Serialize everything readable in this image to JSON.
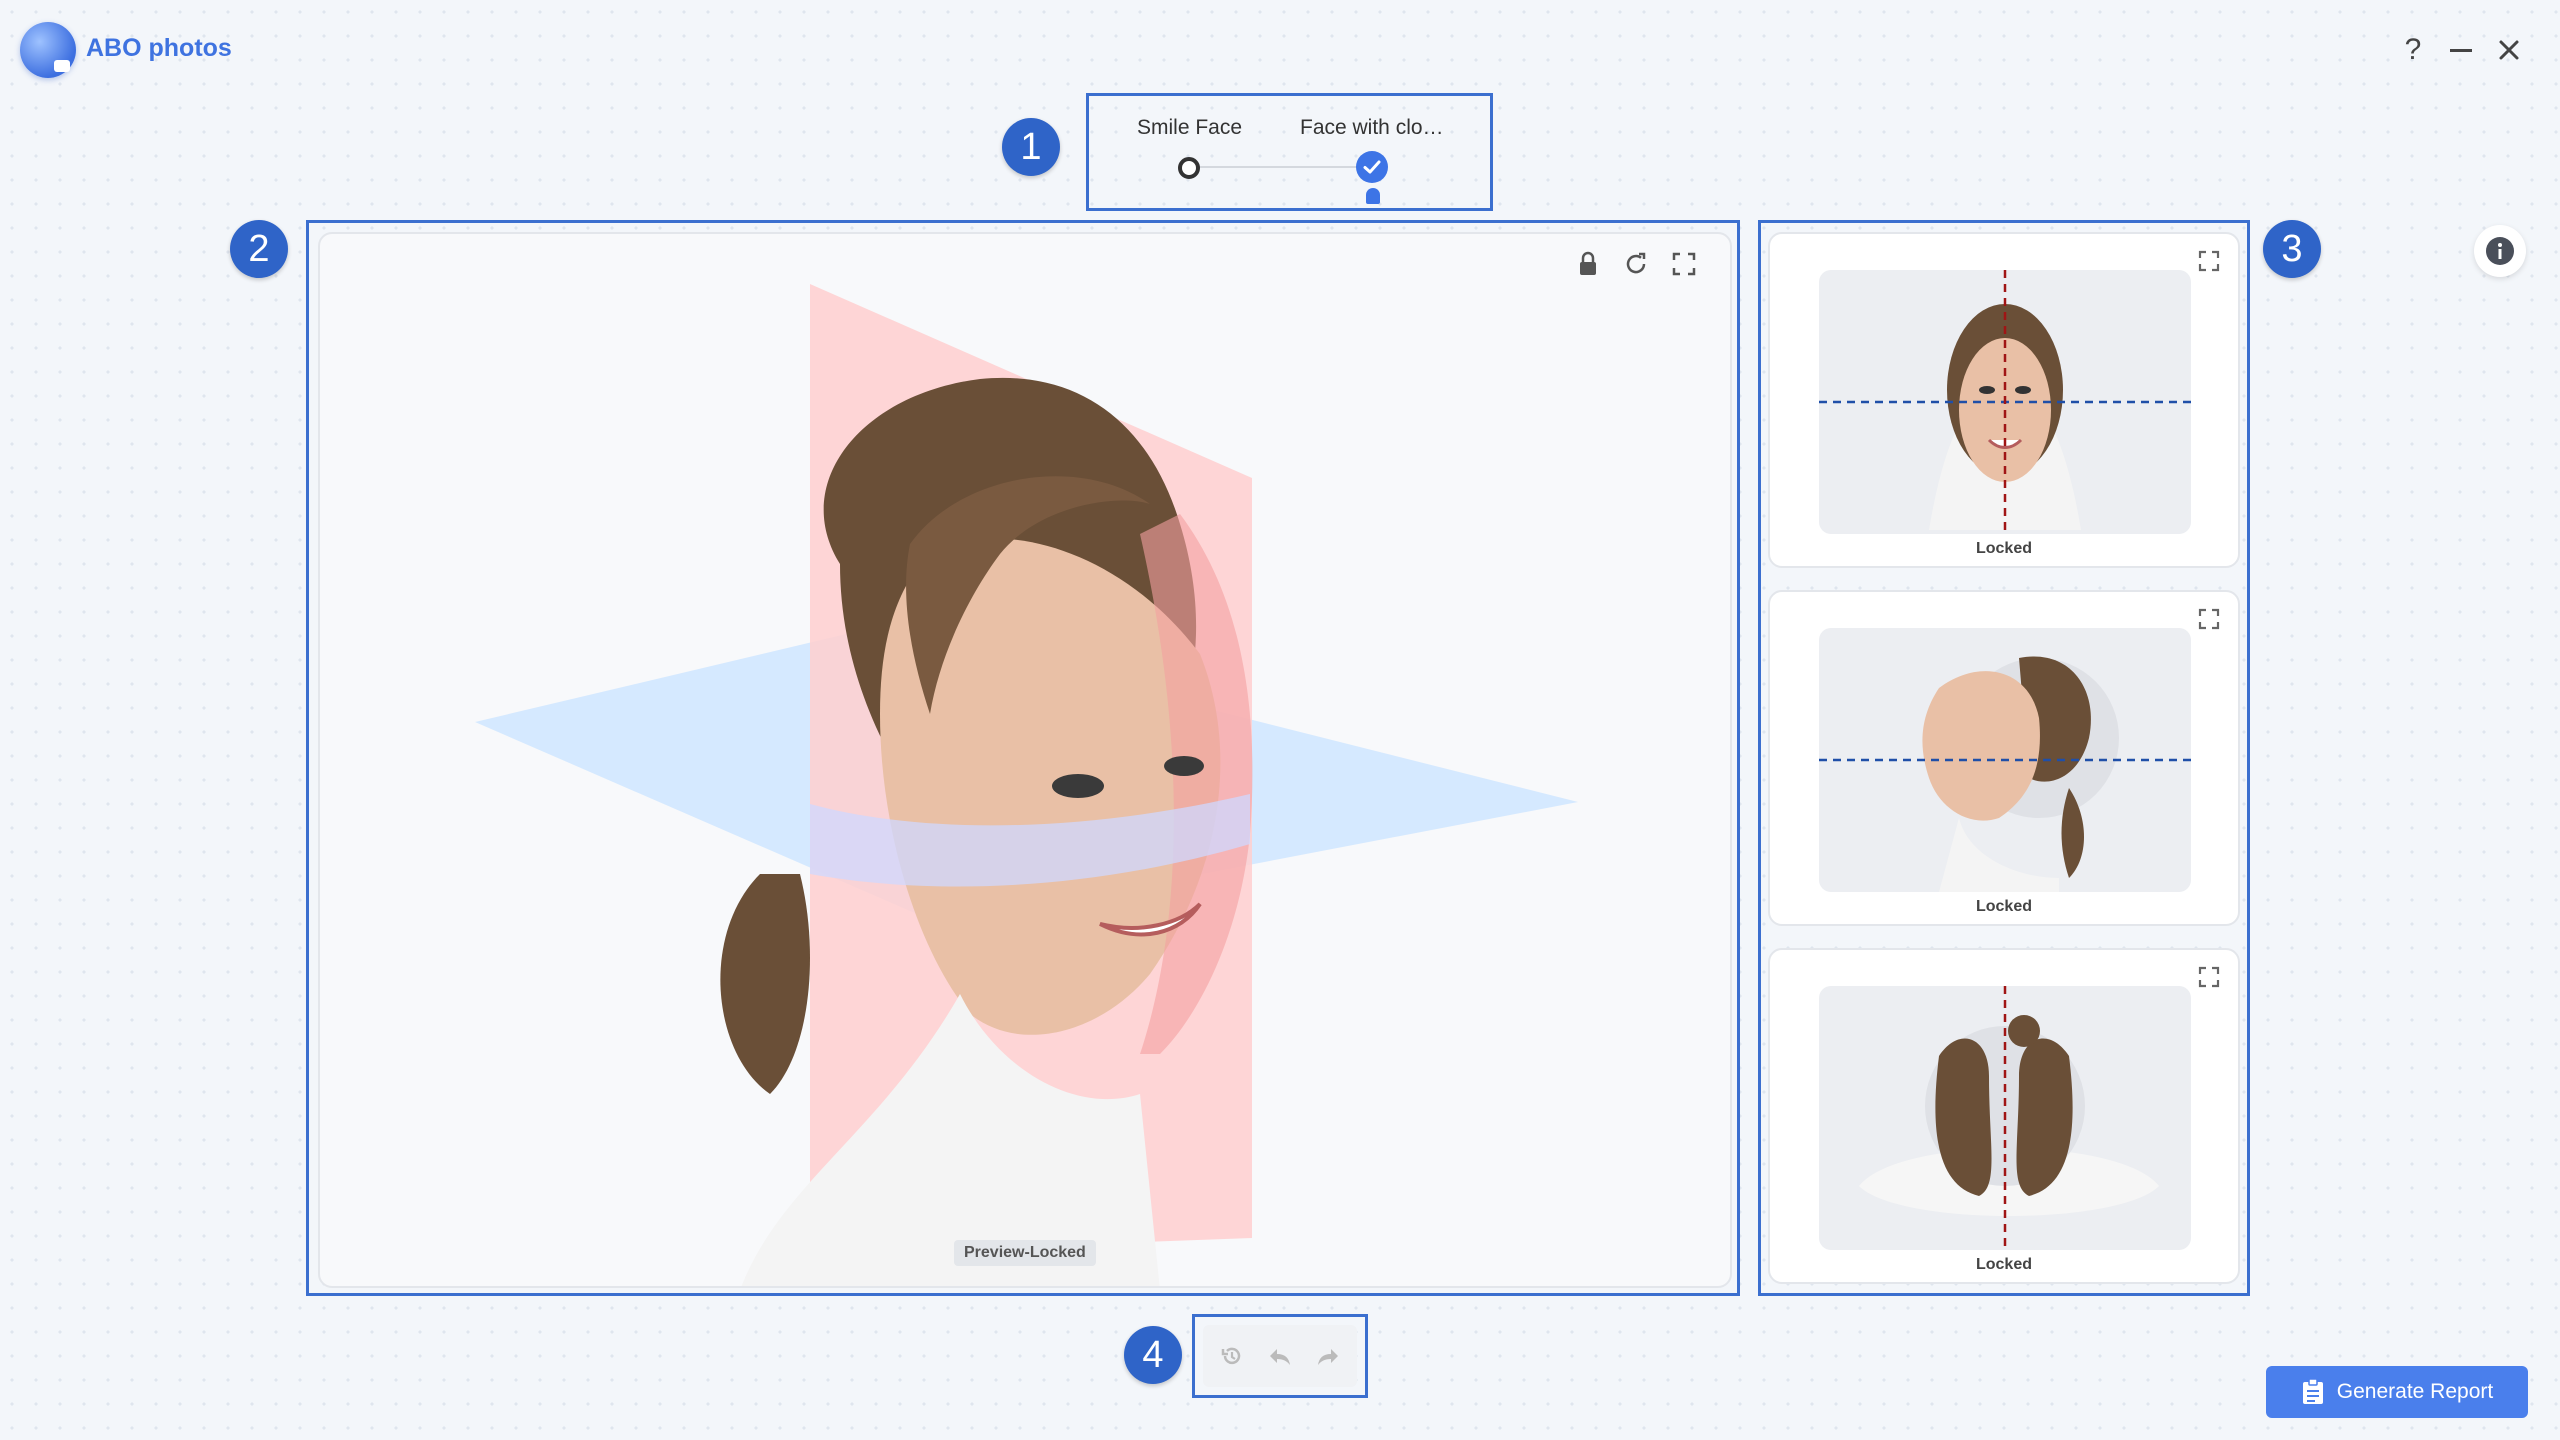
{
  "app": {
    "title": "ABO photos"
  },
  "window": {
    "help": "?",
    "minimize": "—",
    "close": "✕"
  },
  "annotations": [
    "1",
    "2",
    "3",
    "4"
  ],
  "stages": [
    {
      "label": "Smile Face",
      "state": "unchecked"
    },
    {
      "label": "Face with clo…",
      "state": "checked"
    }
  ],
  "viewport": {
    "status_label": "Preview-Locked",
    "tools": [
      "lock-icon",
      "reset-icon",
      "fullscreen-icon"
    ]
  },
  "thumbnails": [
    {
      "view": "frontal",
      "label": "Locked"
    },
    {
      "view": "profile",
      "label": "Locked"
    },
    {
      "view": "top",
      "label": "Locked"
    }
  ],
  "history": {
    "tools": [
      "history-icon",
      "undo-icon",
      "redo-icon"
    ]
  },
  "actions": {
    "generate_report": "Generate Report"
  },
  "colors": {
    "accent": "#3d74e6",
    "annotation": "#2f64c8",
    "frame": "#3b6fcf",
    "sagittal_plane": "#ffb3b3",
    "axial_plane": "#cfe6ff"
  }
}
